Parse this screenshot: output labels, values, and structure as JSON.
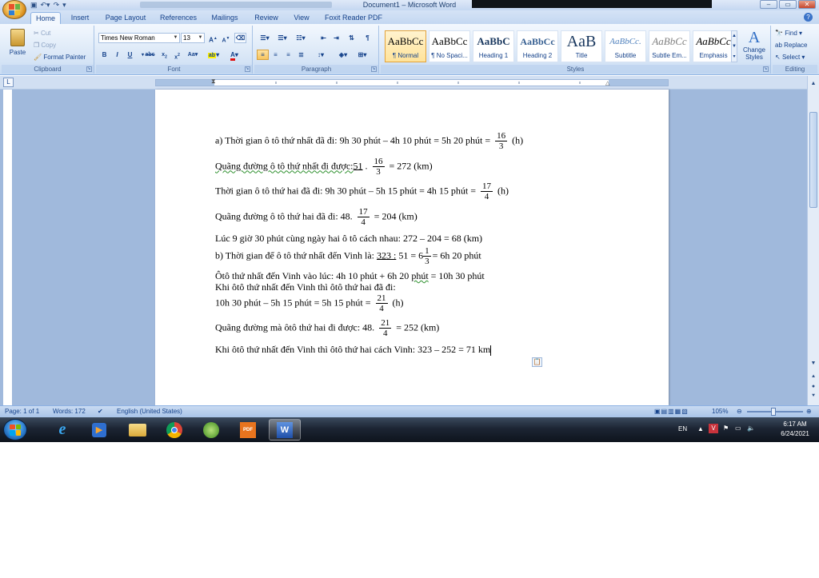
{
  "window": {
    "title": "Document1 – Microsoft Word"
  },
  "tabs": [
    "Home",
    "Insert",
    "Page Layout",
    "References",
    "Mailings",
    "Review",
    "View",
    "Foxit Reader PDF"
  ],
  "clipboard": {
    "paste": "Paste",
    "cut": "Cut",
    "copy": "Copy",
    "format_painter": "Format Painter",
    "label": "Clipboard"
  },
  "font": {
    "name": "Times New Roman",
    "size": "13",
    "label": "Font"
  },
  "paragraph": {
    "label": "Paragraph"
  },
  "styles": {
    "label": "Styles",
    "items": [
      {
        "preview": "AaBbCc",
        "name": "¶ Normal"
      },
      {
        "preview": "AaBbCc",
        "name": "¶ No Spaci..."
      },
      {
        "preview": "AaBbC",
        "name": "Heading 1"
      },
      {
        "preview": "AaBbCc",
        "name": "Heading 2"
      },
      {
        "preview": "AaB",
        "name": "Title"
      },
      {
        "preview": "AaBbCc.",
        "name": "Subtitle"
      },
      {
        "preview": "AaBbCc",
        "name": "Subtle Em..."
      },
      {
        "preview": "AaBbCc",
        "name": "Emphasis"
      }
    ],
    "change_styles": "Change Styles"
  },
  "editing": {
    "label": "Editing",
    "find": "Find",
    "replace": "Replace",
    "select": "Select"
  },
  "doc": {
    "l1": {
      "pre": "a) Thời gian ô tô thứ nhất đã đi:  9h 30 phút – 4h 10 phút = 5h 20 phút =",
      "num": "16",
      "den": "3",
      "post": "(h)"
    },
    "l2": {
      "pre": "Quãng đường ô tô thứ nhất đi được:",
      "pre2": "51",
      "mid": ".",
      "num": "16",
      "den": "3",
      "post": "= 272 (km)"
    },
    "l3": {
      "pre": "Thời gian ô tô thứ hai đã đi: 9h 30 phút – 5h 15 phút = 4h 15 phút =",
      "num": "17",
      "den": "4",
      "post": "(h)"
    },
    "l4": {
      "pre": "Quãng đường ô tô thứ hai đã đi: 48.",
      "num": "17",
      "den": "4",
      "post": "= 204 (km)"
    },
    "l5": "Lúc 9 giờ 30 phút cùng ngày hai ô tô cách nhau: 272 – 204 = 68 (km)",
    "l6": {
      "pre": "b) Thời gian để ô tô thứ nhất đến Vinh là:",
      "u": "323 :",
      "mid": "51 = 6",
      "num": "1",
      "den": "3",
      "post": "=  6h 20 phút"
    },
    "l7": {
      "pre": "Ôtô thứ nhất đến Vinh vào lúc: 4h 10 phút + 6h 20",
      "u": "phút",
      "post": "= 10h 30 phút"
    },
    "l8": "Khi ôtô thứ nhất đến Vinh thì ôtô thứ hai đã đi:",
    "l9": {
      "pre": "10h 30 phút – 5h 15 phút = 5h 15 phút =",
      "num": "21",
      "den": "4",
      "post": "(h)"
    },
    "l10": {
      "pre": "Quãng đường mà ôtô thứ hai đi được: 48.",
      "num": "21",
      "den": "4",
      "post": "= 252 (km)"
    },
    "l11": "Khi ôtô thứ nhất đến Vinh thì ôtô thứ hai cách Vinh: 323 – 252 = 71 km"
  },
  "status": {
    "page": "Page: 1 of 1",
    "words": "Words: 172",
    "language": "English (United States)",
    "zoom": "105%"
  },
  "tray": {
    "lang": "EN",
    "time": "6:17 AM",
    "date": "6/24/2021"
  },
  "colors": {
    "ribbon_text": "#15428b",
    "workspace": "#a0b9dc",
    "taskbar": "#1c2533"
  }
}
